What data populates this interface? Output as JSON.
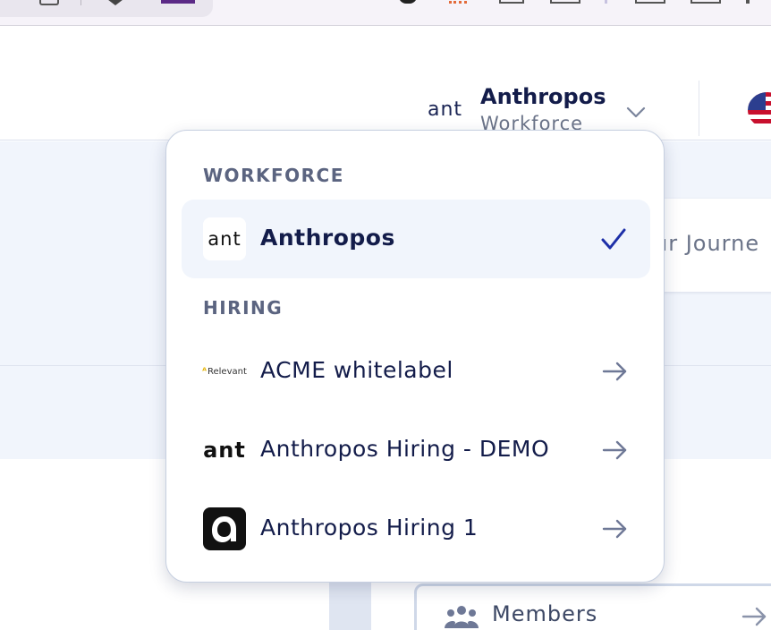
{
  "header": {
    "org_logo_text": "ant",
    "org_name": "Anthropos",
    "org_type": "Workforce"
  },
  "background": {
    "journey_text": "ur Journe",
    "members_label": "Members"
  },
  "dropdown": {
    "sections": [
      {
        "title": "WORKFORCE",
        "items": [
          {
            "label": "Anthropos",
            "logo": "ant",
            "selected": true,
            "icon": "check-icon"
          }
        ]
      },
      {
        "title": "HIRING",
        "items": [
          {
            "label": "ACME whitelabel",
            "logo": "Relevant",
            "icon": "arrow-right-icon"
          },
          {
            "label": "Anthropos Hiring - DEMO",
            "logo": "ant",
            "icon": "arrow-right-icon"
          },
          {
            "label": "Anthropos Hiring 1",
            "logo": "a",
            "icon": "arrow-right-icon"
          }
        ]
      }
    ]
  },
  "colors": {
    "accent": "#1d2fa8",
    "text_primary": "#131c4a",
    "section_label": "#5b6480",
    "selected_bg": "#f1f5fc",
    "page_band": "#f1f5fc"
  }
}
